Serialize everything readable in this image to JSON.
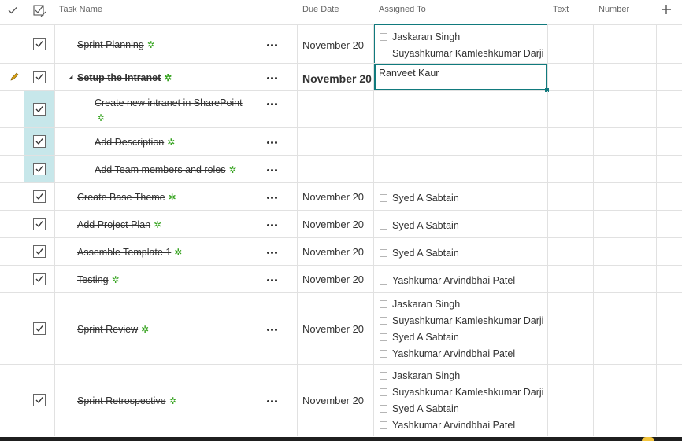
{
  "header": {
    "select_all_icon": "checkmark-icon",
    "task_type_icon": "checklist-icon",
    "columns": {
      "title": "Task Name",
      "due": "Due Date",
      "assigned": "Assigned To",
      "text": "Text",
      "number": "Number"
    },
    "add_column_icon": "plus-icon"
  },
  "rows": [
    {
      "title": "Sprint Planning",
      "due": "November 20",
      "assigned": [
        "Jaskaran Singh",
        "Suyashkumar Kamleshkumar Darji"
      ]
    },
    {
      "title": "Setup the Intranet",
      "due": "November 20",
      "assigned_editing": "Ranveet Kaur",
      "expand_glyph": "◢",
      "editing": true
    },
    {
      "title": "Create new intranet in SharePoint",
      "due": "",
      "assigned": []
    },
    {
      "title": "Add Description",
      "due": "",
      "assigned": []
    },
    {
      "title": "Add Team members and roles",
      "due": "",
      "assigned": []
    },
    {
      "title": "Create Base Theme",
      "due": "November 20",
      "assigned": [
        "Syed A Sabtain"
      ]
    },
    {
      "title": "Add Project Plan",
      "due": "November 20",
      "assigned": [
        "Syed A Sabtain"
      ]
    },
    {
      "title": "Assemble Template 1",
      "due": "November 20",
      "assigned": [
        "Syed A Sabtain"
      ]
    },
    {
      "title": "Testing",
      "due": "November 20",
      "assigned": [
        "Yashkumar Arvindbhai Patel"
      ]
    },
    {
      "title": "Sprint Review",
      "due": "November 20",
      "assigned": [
        "Jaskaran Singh",
        "Suyashkumar Kamleshkumar Darji",
        "Syed A Sabtain",
        "Yashkumar Arvindbhai Patel"
      ]
    },
    {
      "title": "Sprint Retrospective",
      "due": "November 20",
      "assigned": [
        "Jaskaran Singh",
        "Suyashkumar Kamleshkumar Darji",
        "Syed A Sabtain",
        "Yashkumar Arvindbhai Patel"
      ]
    }
  ],
  "new_item_glyph": "✲",
  "colors": {
    "accent": "#117a7d",
    "selected_bg": "#c7e7ea",
    "new_badge": "#36a31f",
    "edit_pencil": "#d69e12"
  }
}
